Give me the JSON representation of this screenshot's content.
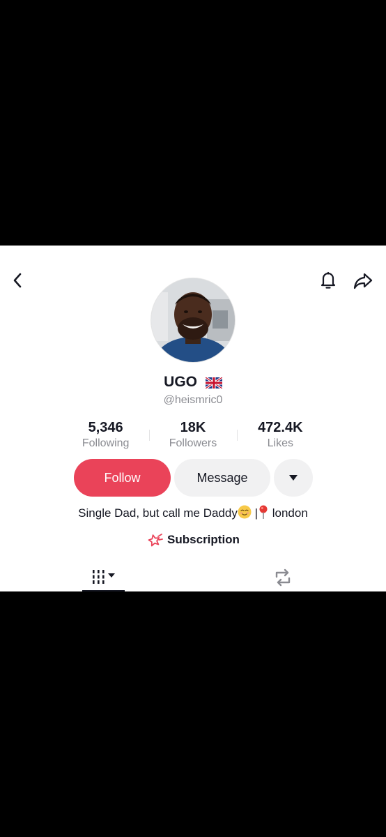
{
  "profile": {
    "display_name": "UGO",
    "flag": "uk-flag-icon",
    "username": "@heismric0",
    "bio_text": "Single Dad, but call me Daddy",
    "bio_separator": "|",
    "bio_location": "london"
  },
  "stats": [
    {
      "value": "5,346",
      "label": "Following"
    },
    {
      "value": "18K",
      "label": "Followers"
    },
    {
      "value": "472.4K",
      "label": "Likes"
    }
  ],
  "actions": {
    "follow_label": "Follow",
    "message_label": "Message"
  },
  "subscription": {
    "label": "Subscription"
  },
  "icons": {
    "back": "chevron-left-icon",
    "notifications": "bell-icon",
    "share": "share-arrow-icon",
    "more": "caret-down-icon",
    "videos_tab": "grid-bars-icon",
    "reposts_tab": "repost-icon"
  },
  "colors": {
    "accent": "#ea4359",
    "secondary_button": "#f1f1f2",
    "muted_text": "#8a8b91"
  }
}
